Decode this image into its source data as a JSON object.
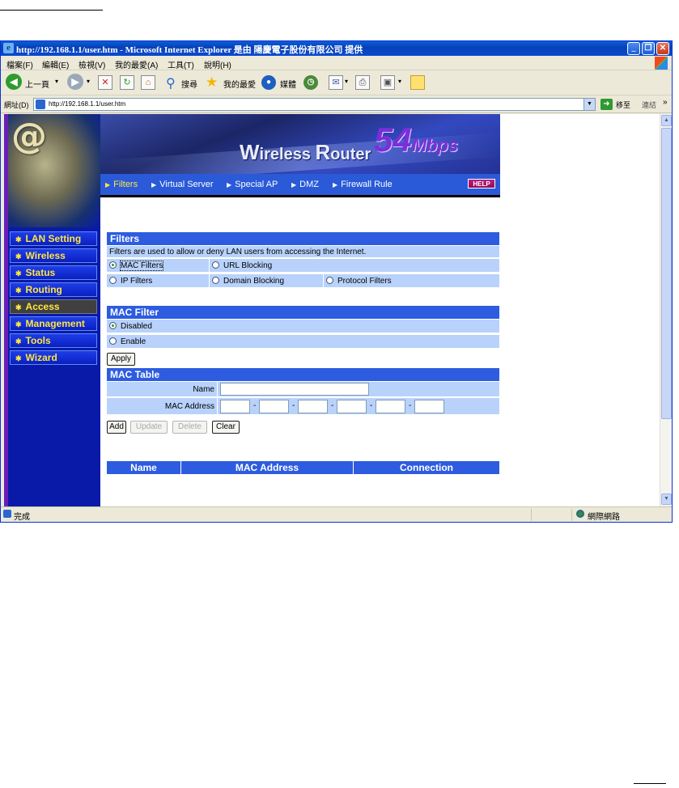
{
  "window": {
    "title": "http://192.168.1.1/user.htm - Microsoft Internet Explorer 是由 陽慶電子股份有限公司 提供",
    "min": "_",
    "max": "❐",
    "close": "✕"
  },
  "menu": [
    "檔案(F)",
    "編輯(E)",
    "檢視(V)",
    "我的最愛(A)",
    "工具(T)",
    "說明(H)"
  ],
  "toolbar": {
    "back": "上一頁",
    "search": "搜尋",
    "favorites": "我的最愛",
    "media": "媒體"
  },
  "address": {
    "label": "網址(D)",
    "url": "http://192.168.1.1/user.htm",
    "go": "移至",
    "links": "連結",
    "more": "»"
  },
  "status": {
    "text": "完成",
    "zone": "網際網路"
  },
  "banner": {
    "title_w": "W",
    "title_rest1": "ireless ",
    "title_r": "R",
    "title_rest2": "outer",
    "speed_num": "54",
    "speed_unit": "Mbps",
    "tabs": [
      "Filters",
      "Virtual Server",
      "Special AP",
      "DMZ",
      "Firewall Rule"
    ],
    "help": "HELP"
  },
  "nav": [
    "LAN Setting",
    "Wireless",
    "Status",
    "Routing",
    "Access",
    "Management",
    "Tools",
    "Wizard"
  ],
  "filters": {
    "title": "Filters",
    "description": "Filters are used to allow or deny LAN users from accessing the Internet.",
    "options": [
      "MAC Filters",
      "URL Blocking",
      "IP Filters",
      "Domain Blocking",
      "Protocol Filters"
    ]
  },
  "mac_filter": {
    "title": "MAC Filter",
    "options": [
      "Disabled",
      "Enable"
    ],
    "apply": "Apply"
  },
  "mac_table": {
    "title": "MAC Table",
    "name_label": "Name",
    "mac_label": "MAC Address",
    "sep": "-",
    "buttons": [
      "Add",
      "Update",
      "Delete",
      "Clear"
    ],
    "columns": [
      "Name",
      "MAC Address",
      "Connection"
    ]
  },
  "colors": {
    "section": "#2d5ce0",
    "row": "#b8d2fb",
    "nav_text": "#ffe640",
    "speed": "#7b2fd8"
  }
}
